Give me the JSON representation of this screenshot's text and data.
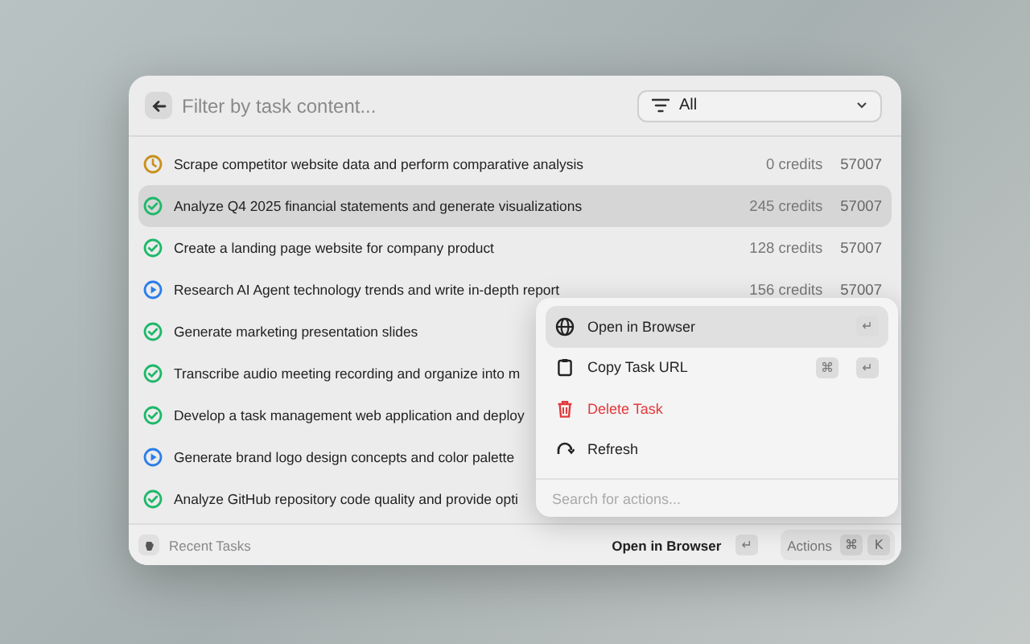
{
  "search": {
    "placeholder": "Filter by task content..."
  },
  "filter": {
    "value": "All"
  },
  "tasks": [
    {
      "title": "Scrape competitor website data and perform comparative analysis",
      "kind": "pending",
      "credits": "0 credits",
      "id": "57007",
      "selected": false
    },
    {
      "title": "Analyze Q4 2025 financial statements and generate visualizations",
      "kind": "done",
      "credits": "245 credits",
      "id": "57007",
      "selected": true
    },
    {
      "title": "Create a landing page website for company product",
      "kind": "done",
      "credits": "128 credits",
      "id": "57007",
      "selected": false
    },
    {
      "title": "Research AI Agent technology trends and write in-depth report",
      "kind": "running",
      "credits": "156 credits",
      "id": "57007",
      "selected": false
    },
    {
      "title": "Generate marketing presentation slides",
      "kind": "done",
      "selected": false
    },
    {
      "title": "Transcribe audio meeting recording and organize into m",
      "kind": "done",
      "selected": false
    },
    {
      "title": "Develop a task management web application and deploy",
      "kind": "done",
      "selected": false
    },
    {
      "title": "Generate brand logo design concepts and color palette",
      "kind": "running",
      "selected": false
    },
    {
      "title": "Analyze GitHub repository code quality and provide opti",
      "kind": "done",
      "selected": false
    }
  ],
  "action_menu": {
    "items": [
      {
        "label": "Open in Browser",
        "kind": "normal",
        "selected": true,
        "shortcut": [
          "↵"
        ]
      },
      {
        "label": "Copy Task URL",
        "kind": "normal",
        "selected": false,
        "shortcut": [
          "⌘",
          "↵"
        ]
      },
      {
        "label": "Delete Task",
        "kind": "danger",
        "selected": false
      },
      {
        "label": "Refresh",
        "kind": "normal",
        "selected": false
      }
    ],
    "search": {
      "placeholder": "Search for actions..."
    }
  },
  "footer": {
    "title": "Recent Tasks",
    "primary_action": "Open in Browser",
    "primary_key": "↵",
    "actions_label": "Actions",
    "actions_keys": [
      "⌘",
      "K"
    ]
  }
}
